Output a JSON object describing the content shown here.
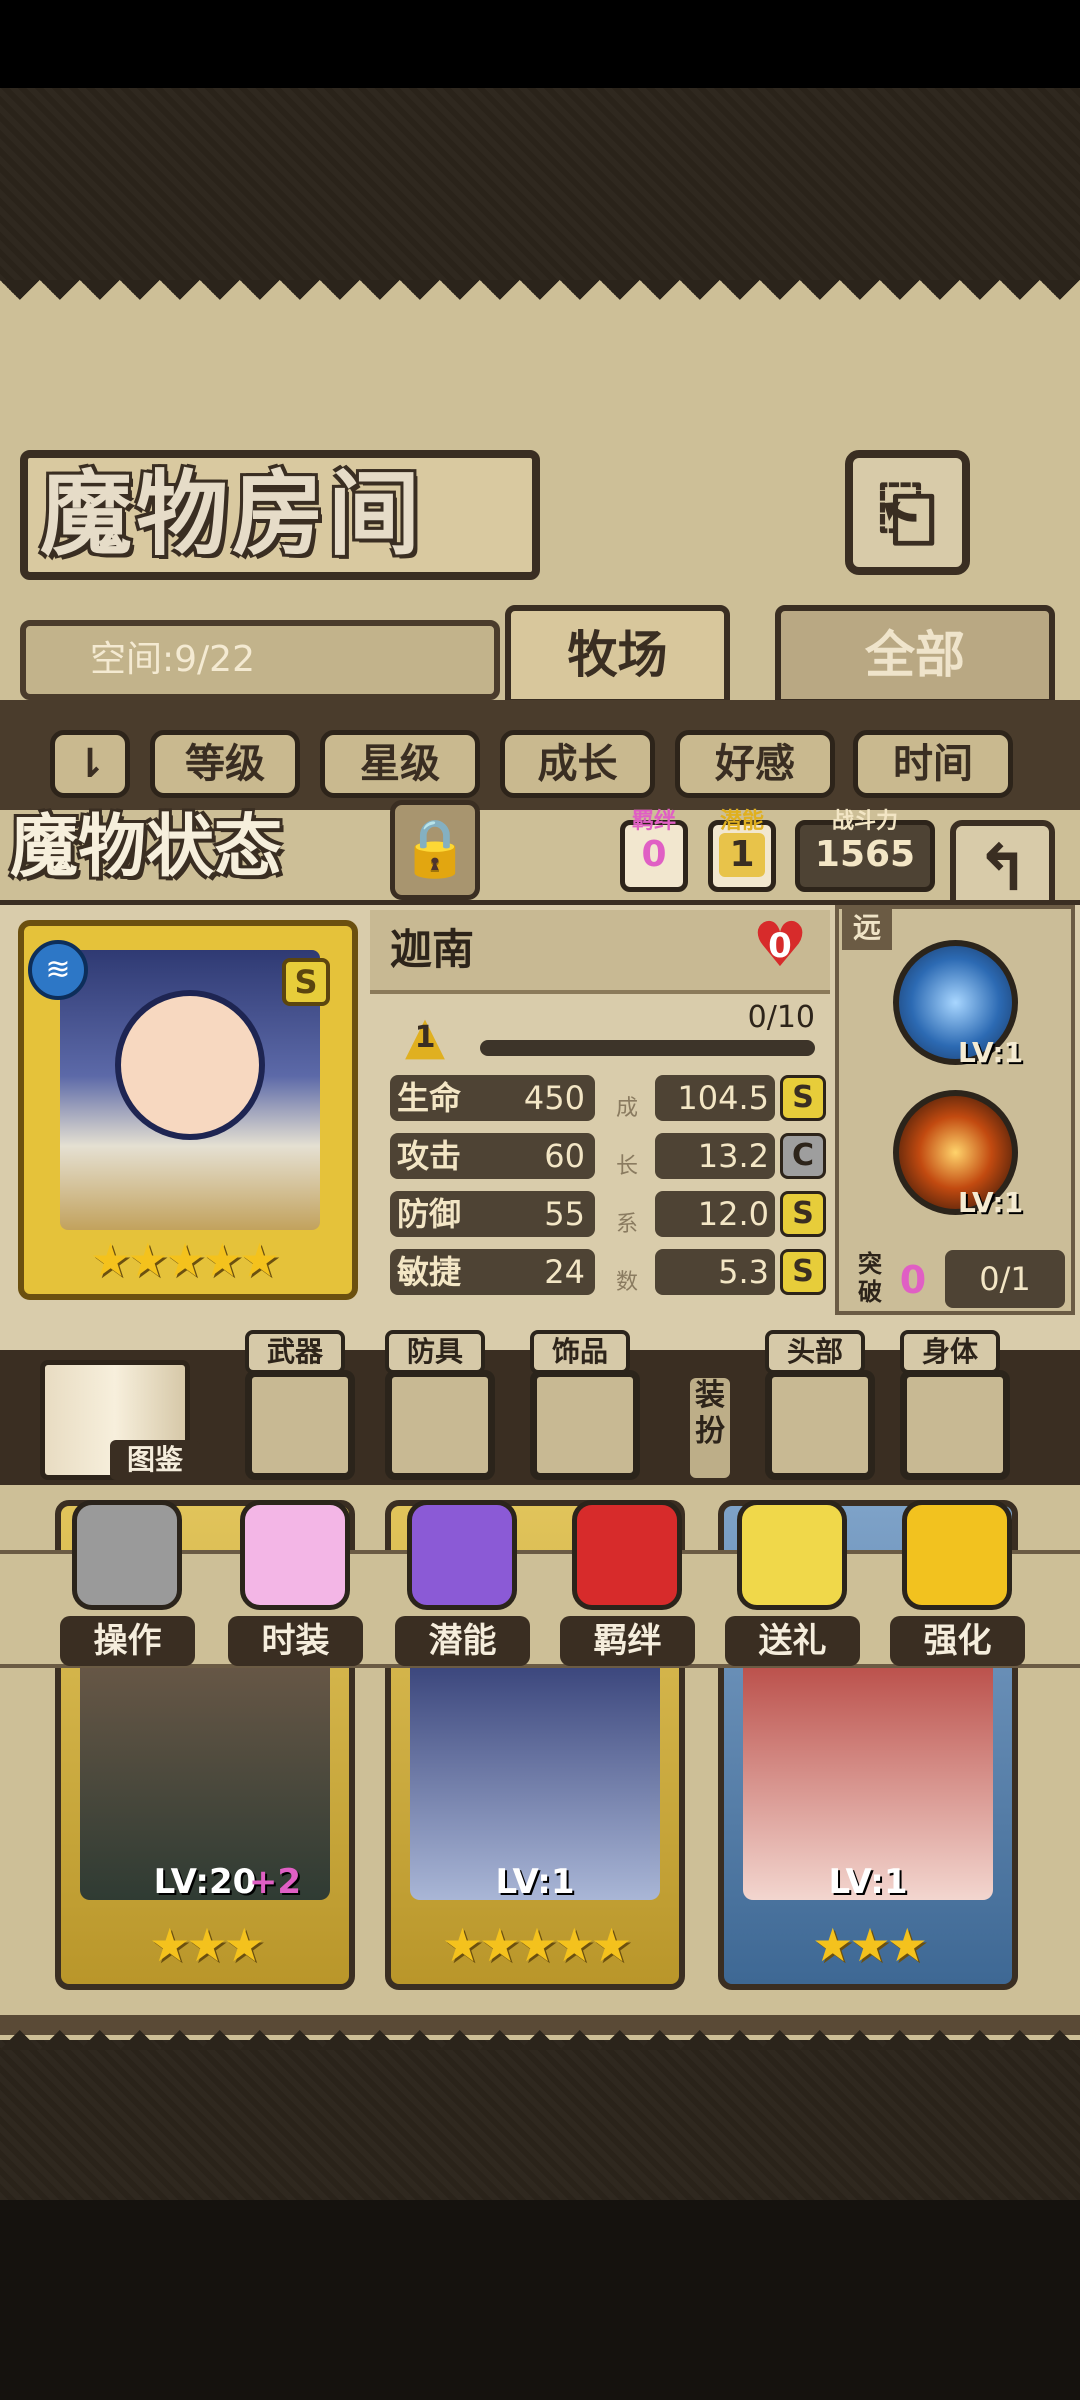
{
  "header": {
    "title": "魔物房间",
    "back_glyph": "⎗",
    "space_text": "空间:9/22"
  },
  "tabs": [
    {
      "label": "牧场",
      "active": true
    },
    {
      "label": "全部",
      "active": false
    }
  ],
  "sort": {
    "toggle_glyph": "⇂",
    "buttons": [
      "等级",
      "星级",
      "成长",
      "好感",
      "时间"
    ]
  },
  "status": {
    "title": "魔物状态",
    "lock_glyph": "🔒",
    "badges": [
      {
        "label": "羁绊",
        "value": "0",
        "color": "#e05fc4"
      },
      {
        "label": "潜能",
        "value": "1",
        "color": "#e0b020"
      },
      {
        "label": "战斗力",
        "value": "1565",
        "color": "#f3e6c5"
      }
    ],
    "back_glyph": "↰"
  },
  "monster": {
    "name": "迦南",
    "favor": "0",
    "rank": "S",
    "element_icon": "water-icon",
    "stars": "★★★★★",
    "potential_level": "1",
    "xp": "0/10",
    "xp_progress": 0,
    "range_tag": "远",
    "growth_label_chars": [
      "成",
      "长",
      "系",
      "数"
    ],
    "stats": [
      {
        "name": "生命",
        "value": "450",
        "growth": "104.5",
        "grade": "S"
      },
      {
        "name": "攻击",
        "value": "60",
        "growth": "13.2",
        "grade": "C"
      },
      {
        "name": "防御",
        "value": "55",
        "growth": "12.0",
        "grade": "S"
      },
      {
        "name": "敏捷",
        "value": "24",
        "growth": "5.3",
        "grade": "S"
      }
    ],
    "skills": [
      {
        "level": "LV:1",
        "icon": "lightning-skill-icon"
      },
      {
        "level": "LV:1",
        "icon": "sword-fire-skill-icon"
      }
    ],
    "breakthrough": {
      "label": "突破",
      "count": "0",
      "progress": "0/1"
    }
  },
  "equipment": {
    "codex_label": "图鉴",
    "slots_left": [
      "武器",
      "防具",
      "饰品"
    ],
    "slots_right": [
      "头部",
      "身体"
    ],
    "pickup_label": "装扮"
  },
  "actions": [
    {
      "label": "操作",
      "color": "#9a9a9a"
    },
    {
      "label": "时装",
      "color": "#f3b6e6"
    },
    {
      "label": "潜能",
      "color": "#8b5ad6"
    },
    {
      "label": "羁绊",
      "color": "#d72b2b"
    },
    {
      "label": "送礼",
      "color": "#f0d84a"
    },
    {
      "label": "强化",
      "color": "#f2c21f"
    }
  ],
  "roster": [
    {
      "level": "LV:20",
      "bonus": "+2",
      "stars": "★★★"
    },
    {
      "level": "LV:1",
      "bonus": "",
      "stars": "★★★★★"
    },
    {
      "level": "LV:1",
      "bonus": "",
      "stars": "★★★"
    }
  ],
  "colors": {
    "panel": "#cdbf97",
    "frame": "#3a2e22",
    "grade_s": "#e7cd3a",
    "grade_c": "#9e9e9e"
  }
}
